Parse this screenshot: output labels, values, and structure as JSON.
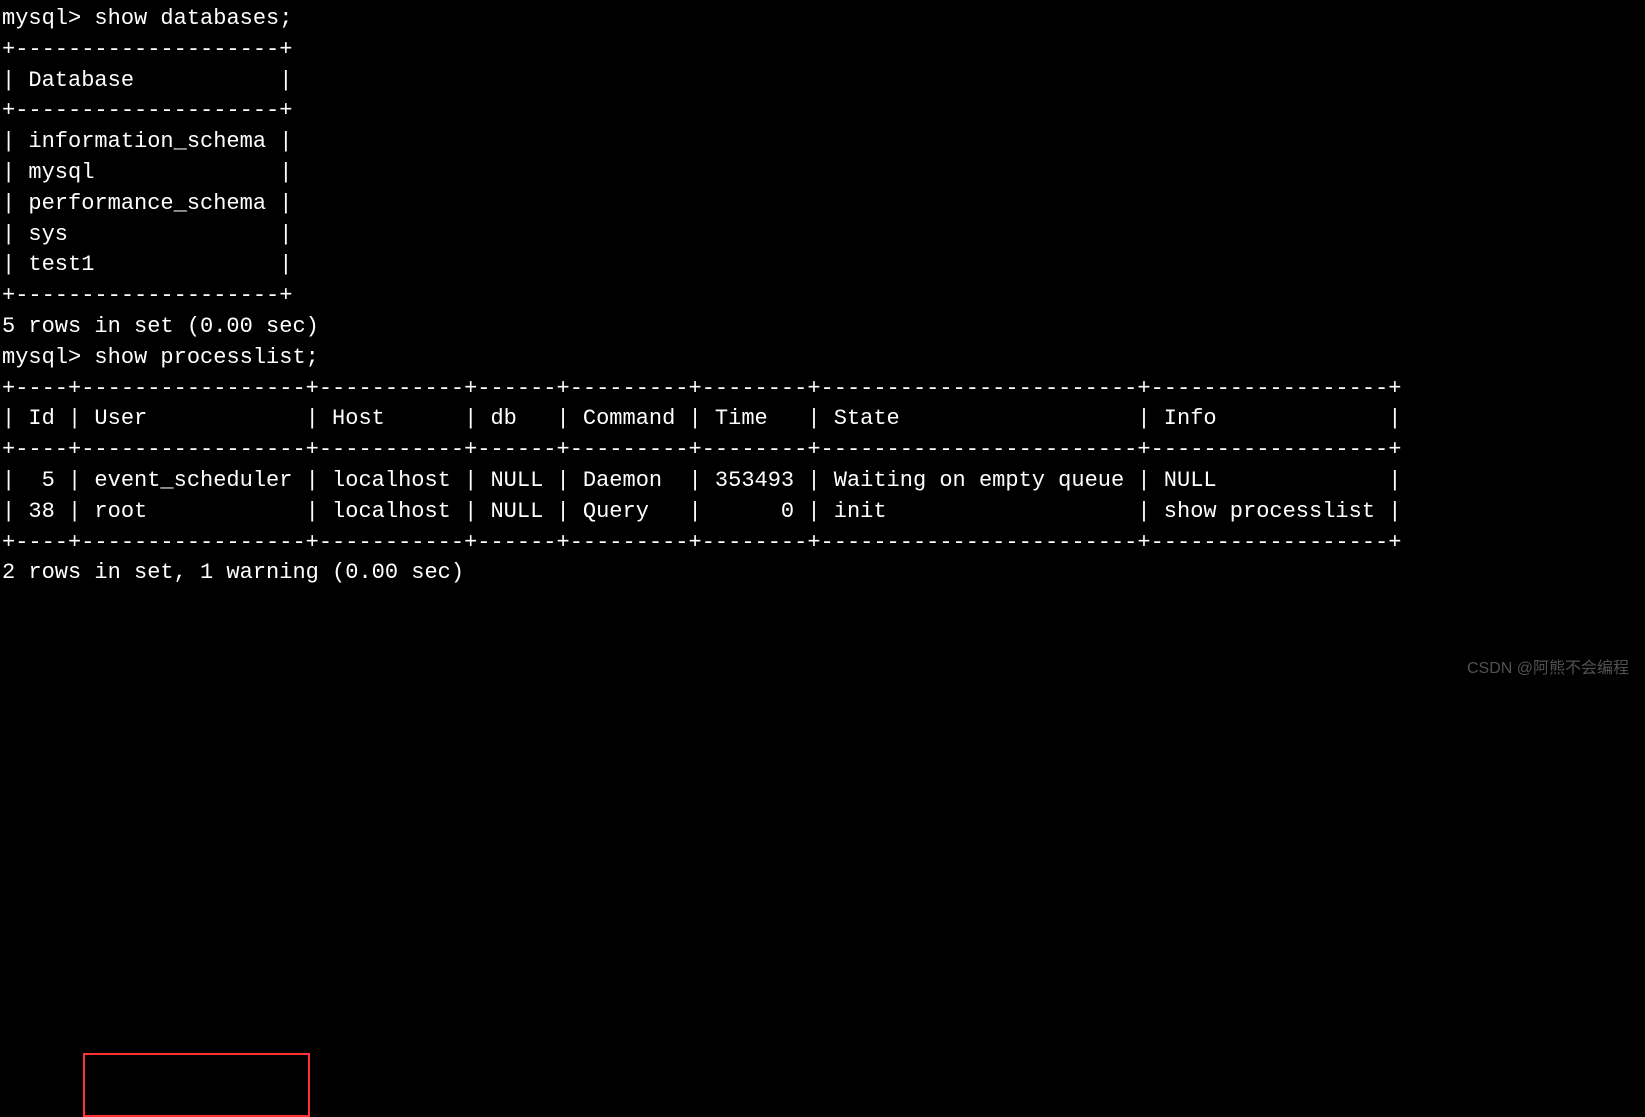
{
  "terminal": {
    "prompt1": "mysql> ",
    "command1": "show databases;",
    "db_border_top": "+--------------------+",
    "db_header": "| Database           |",
    "db_border_mid": "+--------------------+",
    "db_row1": "| information_schema |",
    "db_row2": "| mysql              |",
    "db_row3": "| performance_schema |",
    "db_row4": "| sys                |",
    "db_row5": "| test1              |",
    "db_border_bot": "+--------------------+",
    "db_result": "5 rows in set (0.00 sec)",
    "blank": "",
    "prompt2": "mysql> ",
    "command2": "show processlist;",
    "pl_border_top": "+----+-----------------+-----------+------+---------+--------+------------------------+------------------+",
    "pl_header": "| Id | User            | Host      | db   | Command | Time   | State                  | Info             |",
    "pl_border_mid": "+----+-----------------+-----------+------+---------+--------+------------------------+------------------+",
    "pl_row1": "|  5 | event_scheduler | localhost | NULL | Daemon  | 353493 | Waiting on empty queue | NULL             |",
    "pl_row2": "| 38 | root            | localhost | NULL | Query   |      0 | init                   | show processlist |",
    "pl_border_bot": "+----+-----------------+-----------+------+---------+--------+------------------------+------------------+",
    "pl_result": "2 rows in set, 1 warning (0.00 sec)"
  },
  "databases": {
    "header": "Database",
    "rows": [
      "information_schema",
      "mysql",
      "performance_schema",
      "sys",
      "test1"
    ],
    "result_text": "5 rows in set (0.00 sec)"
  },
  "processlist": {
    "columns": [
      "Id",
      "User",
      "Host",
      "db",
      "Command",
      "Time",
      "State",
      "Info"
    ],
    "rows": [
      {
        "Id": "5",
        "User": "event_scheduler",
        "Host": "localhost",
        "db": "NULL",
        "Command": "Daemon",
        "Time": "353493",
        "State": "Waiting on empty queue",
        "Info": "NULL"
      },
      {
        "Id": "38",
        "User": "root",
        "Host": "localhost",
        "db": "NULL",
        "Command": "Query",
        "Time": "0",
        "State": "init",
        "Info": "show processlist"
      }
    ],
    "result_text": "2 rows in set, 1 warning (0.00 sec)"
  },
  "highlight": {
    "cells": [
      "event_scheduler",
      "root"
    ]
  },
  "watermark": "CSDN @阿熊不会编程"
}
